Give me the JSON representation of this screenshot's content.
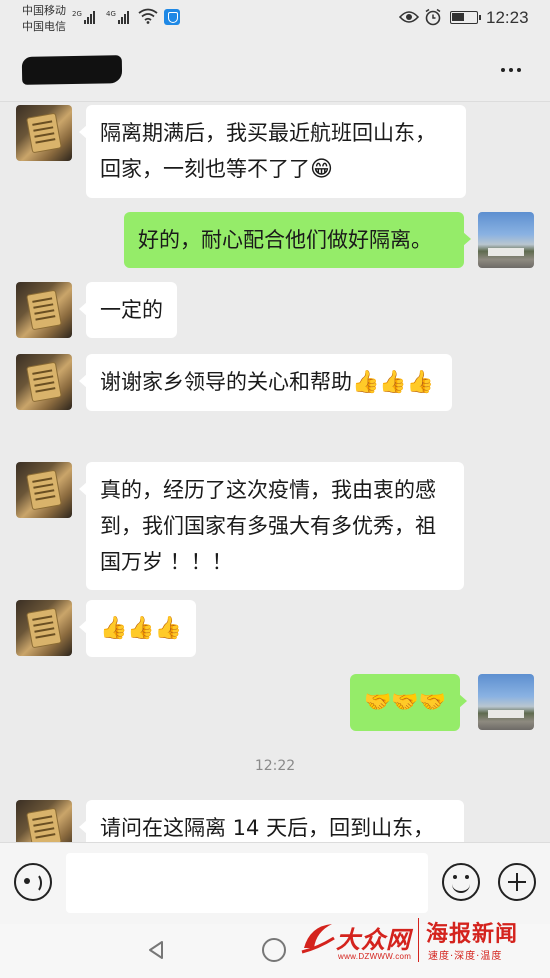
{
  "status_bar": {
    "carrier_1": "中国移动",
    "carrier_2": "中国电信",
    "signal_1_tag": "2G",
    "signal_2_tag": "4G",
    "time": "12:23",
    "icons": [
      "signal-icon",
      "wifi-icon",
      "app-shield-icon",
      "eye-comfort-icon",
      "alarm-icon",
      "battery-icon"
    ]
  },
  "title_bar": {
    "contact_name": "",
    "more_icon": "more-icon"
  },
  "messages": [
    {
      "side": "in",
      "text": "隔离期满后，我买最近航班回山东，回家，一刻也等不了了",
      "emoji": "😁"
    },
    {
      "side": "out",
      "text": "好的，耐心配合他们做好隔离。",
      "emoji": ""
    },
    {
      "side": "in",
      "text": "一定的",
      "emoji": ""
    },
    {
      "side": "in",
      "text": "谢谢家乡领导的关心和帮助",
      "emoji": "👍👍👍"
    },
    {
      "side": "in",
      "text": "真的，经历了这次疫情，我由衷的感到，我们国家有多强大有多优秀，祖国万岁 ！！！",
      "emoji": ""
    },
    {
      "side": "in",
      "text": "",
      "emoji": "👍👍👍"
    },
    {
      "side": "out",
      "text": "",
      "emoji": "🤝🤝🤝"
    },
    {
      "side": "time",
      "text": "12:22"
    },
    {
      "side": "in",
      "text": "请问在这隔离 14 天后，回到山东，",
      "emoji": ""
    }
  ],
  "input_bar": {
    "placeholder": "",
    "voice_icon": "voice-icon",
    "emoji_icon": "emoji-icon",
    "plus_icon": "plus-icon"
  },
  "nav_bar": {
    "icons": [
      "back-icon",
      "home-icon"
    ]
  },
  "watermark": {
    "site_name": "大众网",
    "site_url": "www.DZWWW.com",
    "news_name": "海报新闻",
    "slogan": "速度·深度·温度"
  },
  "colors": {
    "chat_background": "#ebebeb",
    "incoming_bubble": "#ffffff",
    "outgoing_bubble": "#95ec69",
    "watermark_red": "#d4231d"
  }
}
